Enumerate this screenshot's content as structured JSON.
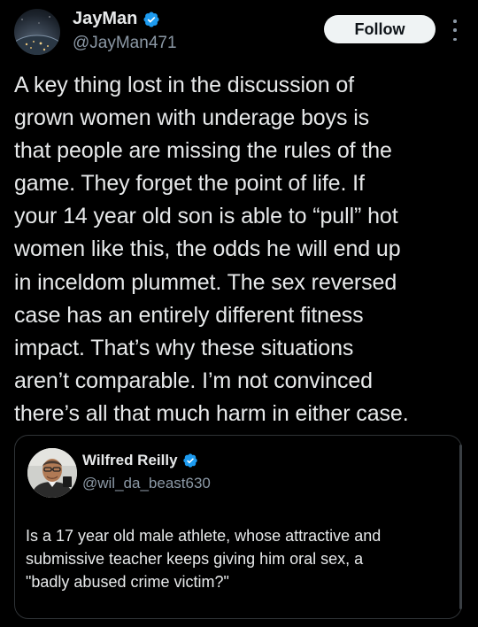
{
  "tweet": {
    "author": {
      "display_name": "JayMan",
      "handle": "@JayMan471",
      "verified_icon": "verified-badge-icon",
      "avatar_icon": "earth-at-night-avatar"
    },
    "follow_label": "Follow",
    "more_icon": "more-vertical-icon",
    "text": "A key thing lost in the discussion of\ngrown women with underage boys is\nthat people are missing the rules of the\ngame. They forget the point of life. If\nyour 14 year old son is able to “pull” hot\nwomen like this, the odds he will end up\nin inceldom plummet. The sex reversed\ncase has an entirely different fitness\nimpact. That’s why these situations\naren’t comparable. I’m not convinced\nthere’s all that much harm in either case."
  },
  "quoted_tweet": {
    "author": {
      "display_name": "Wilfred Reilly",
      "handle": "@wil_da_beast630",
      "verified_icon": "verified-badge-icon",
      "avatar_icon": "person-photo-avatar"
    },
    "text": "Is a 17 year old male athlete, whose attractive and\nsubmissive teacher keeps giving him oral sex, a\n\"badly abused crime victim?\""
  },
  "colors": {
    "background": "#000000",
    "text_primary": "#e7e9ea",
    "text_secondary": "#8b98a5",
    "verified_blue": "#1d9bf0",
    "follow_button_bg": "#eff3f4",
    "card_border": "#2f3336"
  }
}
